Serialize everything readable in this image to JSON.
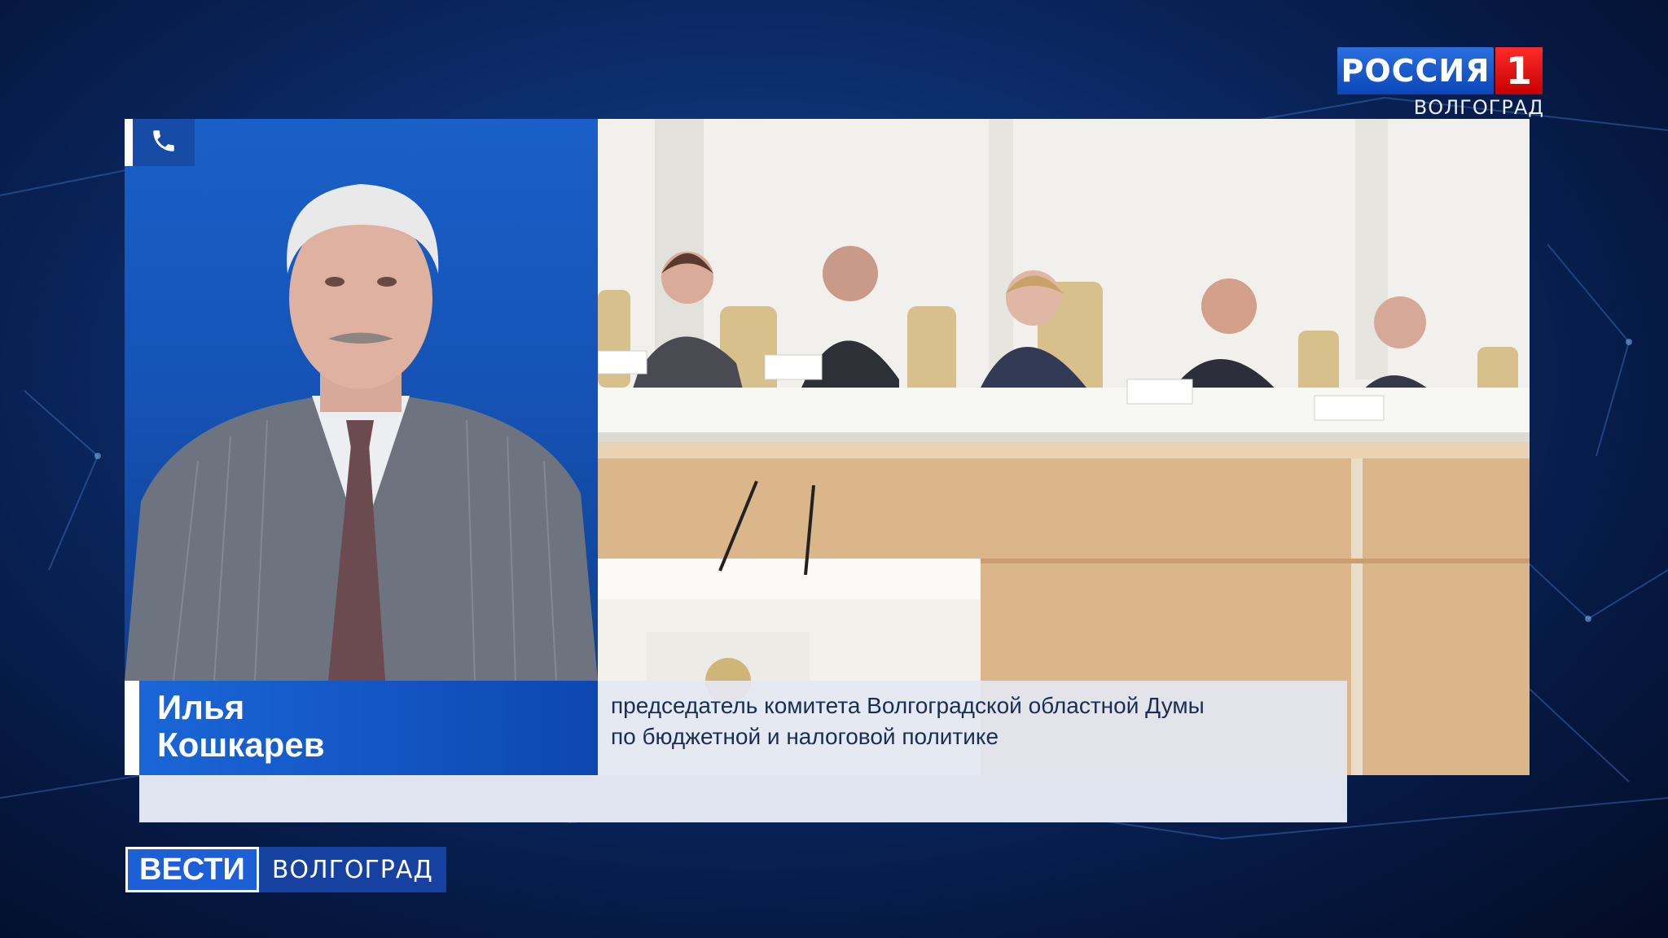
{
  "channel": {
    "name": "РОССИЯ",
    "number": "1",
    "region": "ВОЛГОГРАД"
  },
  "badge": {
    "icon": "phone-icon"
  },
  "caption": {
    "name_line1": "Илья",
    "name_line2": "Кошкарев",
    "title_line1": "председатель комитета Волгоградской областной Думы",
    "title_line2": "по бюджетной и налоговой политике"
  },
  "program": {
    "brand": "ВЕСТИ",
    "region": "ВОЛГОГРАД"
  },
  "colors": {
    "accent": "#1d5fd6",
    "channel_red": "#d80000",
    "background": "#0d2f70"
  }
}
